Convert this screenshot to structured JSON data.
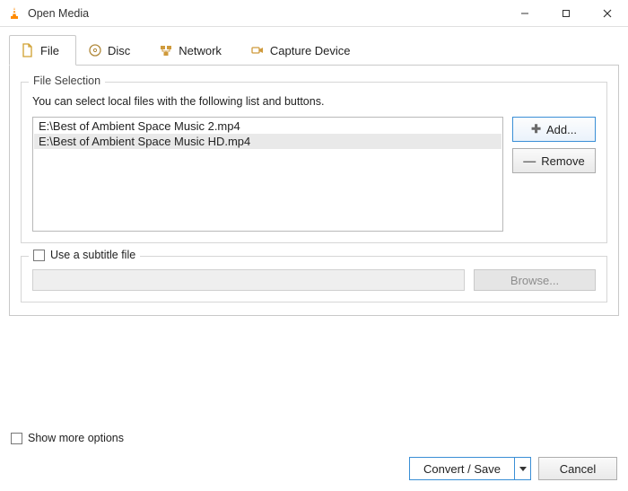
{
  "window": {
    "title": "Open Media"
  },
  "tabs": {
    "file": "File",
    "disc": "Disc",
    "network": "Network",
    "capture": "Capture Device"
  },
  "file_selection": {
    "group_title": "File Selection",
    "hint": "You can select local files with the following list and buttons.",
    "files": [
      "E:\\Best of Ambient Space Music 2.mp4",
      "E:\\Best of Ambient Space Music HD.mp4"
    ],
    "add": "Add...",
    "remove": "Remove"
  },
  "subtitle": {
    "toggle_label": "Use a subtitle file",
    "browse": "Browse..."
  },
  "more_options": "Show more options",
  "footer": {
    "convert_save": "Convert / Save",
    "cancel": "Cancel"
  }
}
